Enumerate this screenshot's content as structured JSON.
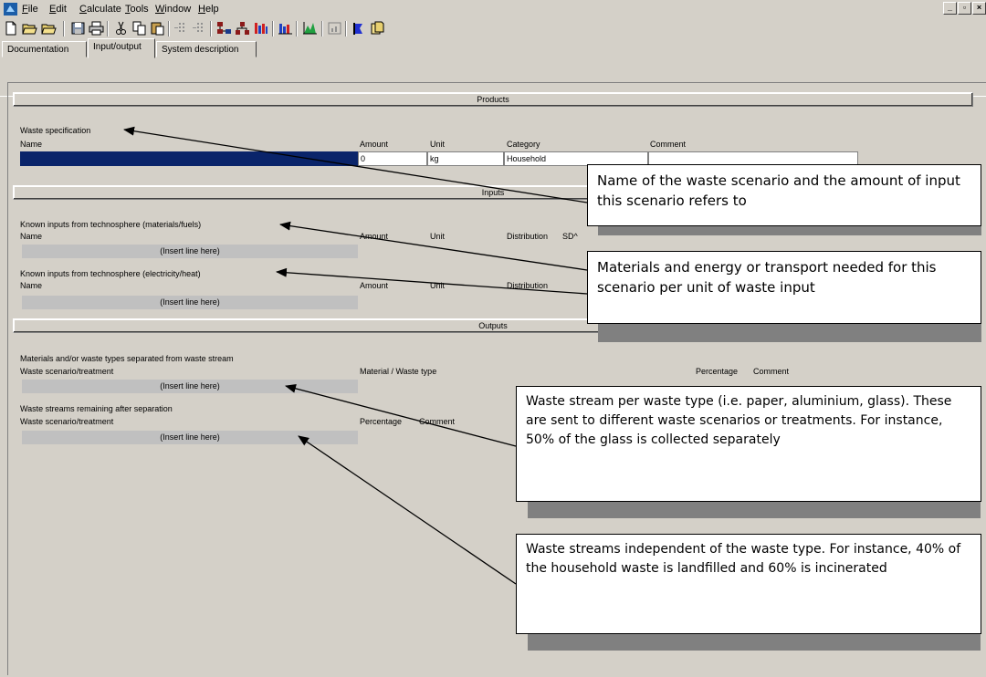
{
  "menu": {
    "items": [
      {
        "label": "File",
        "underline": "F",
        "rest": "ile"
      },
      {
        "label": "Edit",
        "underline": "E",
        "rest": "dit"
      },
      {
        "label": "Calculate",
        "underline": "C",
        "rest": "alculate"
      },
      {
        "label": "Tools",
        "underline": "T",
        "rest": "ools"
      },
      {
        "label": "Window",
        "underline": "W",
        "rest": "indow"
      },
      {
        "label": "Help",
        "underline": "H",
        "rest": "elp"
      }
    ],
    "window_buttons": [
      "_",
      "▫",
      "×"
    ]
  },
  "tabs": [
    {
      "label": "Documentation",
      "active": false
    },
    {
      "label": "Input/output",
      "active": true
    },
    {
      "label": "System description",
      "active": false
    }
  ],
  "sections": {
    "products": "Products",
    "inputs": "Inputs",
    "outputs": "Outputs"
  },
  "waste_spec": {
    "title": "Waste specification",
    "headers": {
      "name": "Name",
      "amount": "Amount",
      "unit": "Unit",
      "category": "Category",
      "comment": "Comment"
    },
    "row": {
      "name": "",
      "amount": "0",
      "unit": "kg",
      "category": "Household",
      "comment": ""
    }
  },
  "inputs": {
    "materials_title": "Known inputs from technosphere (materials/fuels)",
    "electricity_title": "Known inputs from technosphere (electricity/heat)",
    "headers": {
      "name": "Name",
      "amount": "Amount",
      "unit": "Unit",
      "distribution": "Distribution",
      "sd": "SD^"
    },
    "insert_line": "(Insert line here)"
  },
  "outputs": {
    "separated_title": "Materials and/or waste types separated from waste stream",
    "separated_headers": {
      "scenario": "Waste scenario/treatment",
      "material": "Material / Waste type",
      "percentage": "Percentage",
      "comment": "Comment"
    },
    "remaining_title": "Waste streams remaining after separation",
    "remaining_headers": {
      "scenario": "Waste scenario/treatment",
      "percentage": "Percentage",
      "comment": "Comment"
    },
    "insert_line": "(Insert line here)"
  },
  "callouts": [
    {
      "text": "Name of the waste scenario and the amount of input this scenario refers to"
    },
    {
      "text": "Materials and energy or transport needed for this scenario per unit of waste input"
    },
    {
      "text": "Waste stream per waste type (i.e. paper, aluminium, glass). These are sent to different waste scenarios or treatments. For instance, 50% of the glass is collected separately"
    },
    {
      "text": "Waste streams independent of the waste type. For instance, 40% of the household waste is landfilled and 60% is incinerated"
    }
  ],
  "colors": {
    "window_bg": "#d4d0c8",
    "selection": "#0a246a",
    "insert_bg": "#c0c0c0"
  }
}
